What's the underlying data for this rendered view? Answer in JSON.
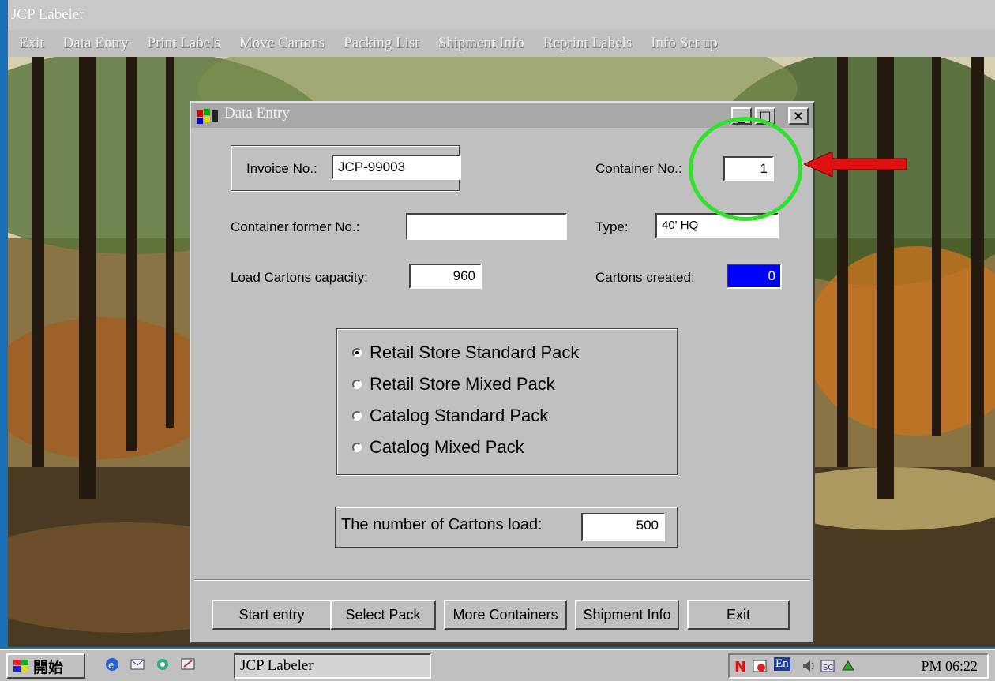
{
  "app": {
    "title": "JCP Labeler"
  },
  "menu": [
    "Exit",
    "Data Entry",
    "Print Labels",
    "Move Cartons",
    "Packing List",
    "Shipment Info",
    "Reprint Labels",
    "Info Set up"
  ],
  "dialog": {
    "title": "Data Entry",
    "window_buttons": {
      "minimize": "_",
      "maximize": "□",
      "close": "×"
    },
    "invoice": {
      "label": "Invoice No.:",
      "value": "JCP-99003"
    },
    "container_no": {
      "label": "Container No.:",
      "value": "1"
    },
    "container_former": {
      "label": "Container former No.:",
      "value": ""
    },
    "type": {
      "label": "Type:",
      "value": "40' HQ"
    },
    "capacity": {
      "label": "Load Cartons capacity:",
      "value": "960"
    },
    "cartons_created": {
      "label": "Cartons created:",
      "value": "0"
    },
    "pack_options": [
      {
        "label": "Retail Store Standard Pack",
        "selected": true
      },
      {
        "label": "Retail Store Mixed Pack",
        "selected": false
      },
      {
        "label": "Catalog Standard Pack",
        "selected": false
      },
      {
        "label": "Catalog Mixed Pack",
        "selected": false
      }
    ],
    "cartons_load": {
      "label": "The number of Cartons load:",
      "value": "500"
    },
    "buttons": [
      "Start entry",
      "Select Pack",
      "More Containers",
      "Shipment Info",
      "Exit"
    ]
  },
  "taskbar": {
    "start_label": "開始",
    "active_app": "JCP Labeler",
    "tray_lang": "En",
    "clock": "PM 06:22"
  },
  "colors": {
    "highlight_circle": "#31e12c",
    "arrow": "#e01010",
    "cartons_created_bg": "#0000ff",
    "desktop": "#1a6fb5"
  }
}
